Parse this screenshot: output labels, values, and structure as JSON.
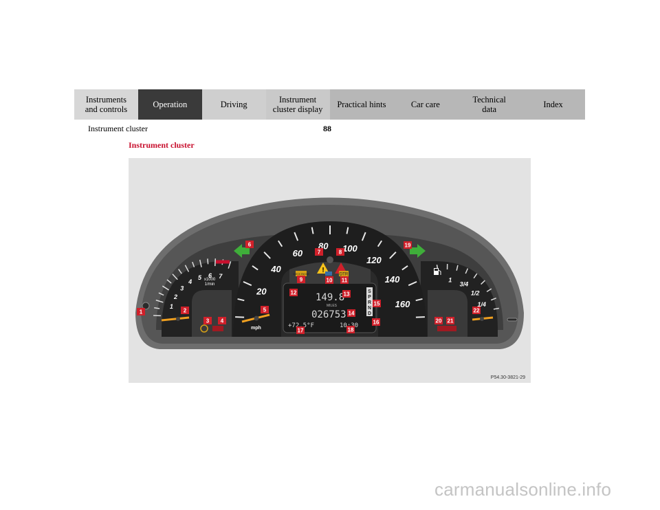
{
  "tabs": [
    {
      "label": "Instruments\nand controls",
      "active": false
    },
    {
      "label": "Operation",
      "active": true
    },
    {
      "label": "Driving",
      "active": false
    },
    {
      "label": "Instrument\ncluster display",
      "active": false
    },
    {
      "label": "Practical hints",
      "active": false
    },
    {
      "label": "Car care",
      "active": false
    },
    {
      "label": "Technical\ndata",
      "active": false
    },
    {
      "label": "Index",
      "active": false
    }
  ],
  "header": {
    "section": "Instrument cluster",
    "page": "88"
  },
  "title": "Instrument cluster",
  "figure": {
    "code": "P54.30-3821-29",
    "tach": {
      "ticks": [
        "1",
        "2",
        "3",
        "4",
        "5",
        "6",
        "7"
      ],
      "unit_top": "x1000",
      "unit_bottom": "1/min"
    },
    "speedo": {
      "ticks": [
        "20",
        "40",
        "60",
        "80",
        "100",
        "120",
        "140",
        "160"
      ],
      "unit": "mph"
    },
    "fuel": {
      "ticks": [
        "1/4",
        "1/2",
        "3/4",
        "1"
      ]
    },
    "display": {
      "trip": "149.8",
      "miles_label": "MILES",
      "odometer": "026753",
      "temp": "+72.5°F",
      "clock": "10:30",
      "gears": [
        "S",
        "P",
        "R",
        "N",
        "D"
      ]
    },
    "lamps": {
      "check_engine": "CHECK ENGINE",
      "dtr": "DTR"
    },
    "callouts": [
      "1",
      "2",
      "3",
      "4",
      "5",
      "6",
      "7",
      "8",
      "9",
      "10",
      "11",
      "12",
      "13",
      "14",
      "15",
      "16",
      "17",
      "18",
      "19",
      "20",
      "21",
      "22"
    ],
    "colors": {
      "callout": "#d0202a",
      "turn_arrow": "#3fae3a",
      "needle": "#f0a020"
    }
  },
  "watermark": "carmanualsonline.info"
}
